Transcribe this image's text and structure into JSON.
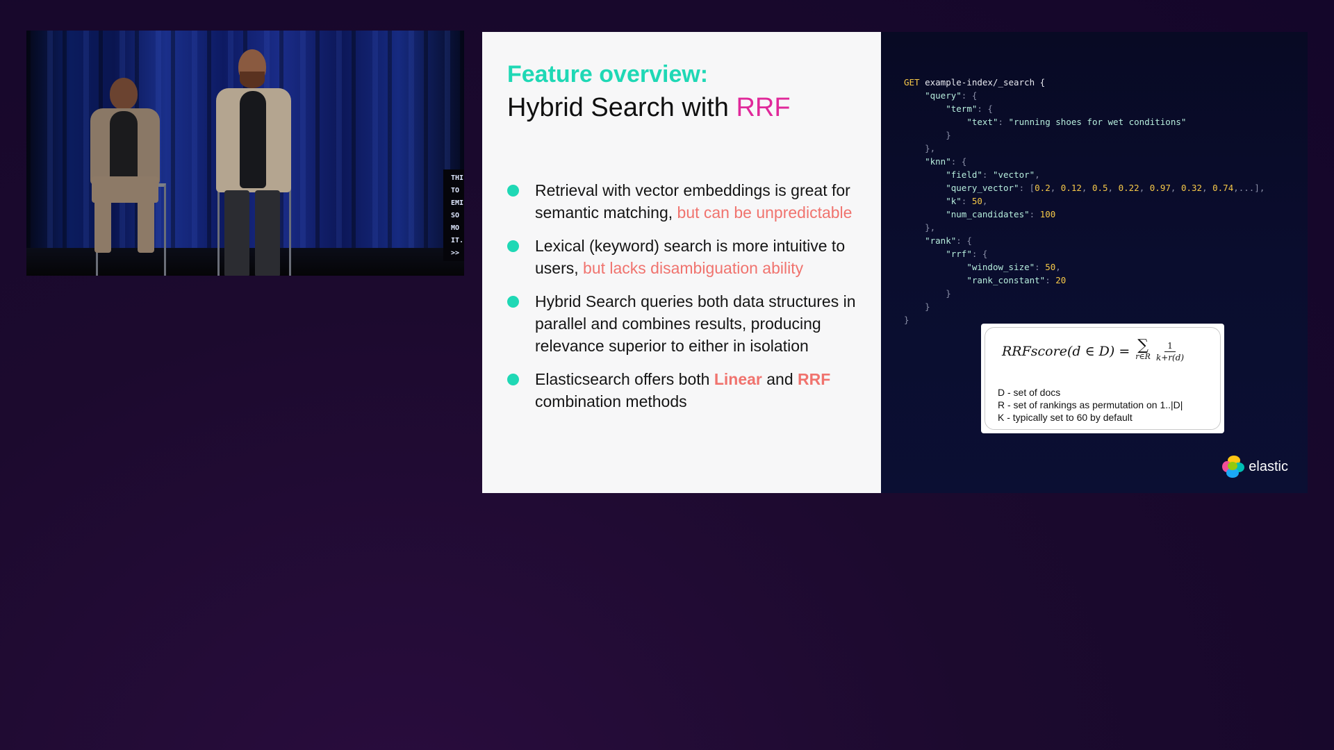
{
  "video": {
    "caption_lines": [
      "THI",
      "TO",
      "EMI",
      "SO",
      "MO",
      "IT.",
      ">>"
    ]
  },
  "slide": {
    "title_line1": "Feature overview:",
    "title_line2_prefix": "Hybrid Search with ",
    "title_line2_accent": "RRF",
    "bullets": [
      {
        "text": "Retrieval with vector embeddings is great for semantic matching, ",
        "highlight": "but can be unpredictable"
      },
      {
        "text": "Lexical (keyword) search is more intuitive to users, ",
        "highlight": "but lacks disambiguation ability"
      },
      {
        "text": "Hybrid Search queries both data structures in parallel and combines results, producing relevance superior to either in isolation"
      },
      {
        "pre": "Elasticsearch offers both ",
        "b1": "Linear",
        "mid": " and ",
        "b2": "RRF",
        "post": " combination methods"
      }
    ],
    "code_lines": [
      [
        "GET",
        " example-index/_search {"
      ],
      [
        "    \"query\": {"
      ],
      [
        "        \"term\": {"
      ],
      [
        "            \"text\": \"running shoes for wet conditions\""
      ],
      [
        "        }"
      ],
      [
        "    },"
      ],
      [
        "    \"knn\": {"
      ],
      [
        "        \"field\": \"vector\","
      ],
      [
        "        \"query_vector\": [0.2, 0.12, 0.5, 0.22, 0.97, 0.32, 0.74,...],"
      ],
      [
        "        \"k\": 50,"
      ],
      [
        "        \"num_candidates\": 100"
      ],
      [
        "    },"
      ],
      [
        "    \"rank\": {"
      ],
      [
        "        \"rrf\": {"
      ],
      [
        "            \"window_size\": 50,"
      ],
      [
        "            \"rank_constant\": 20"
      ],
      [
        "        }"
      ],
      [
        "    }"
      ],
      [
        "}"
      ]
    ],
    "formula": {
      "lhs": "RRFscore(d ∈ D) =",
      "sigma": "∑",
      "sigma_sub": "r∈R",
      "numerator": "1",
      "denominator": "k+r(d)"
    },
    "definitions": [
      "D - set of docs",
      "R - set of rankings as permutation on 1..|D|",
      "K - typically set to 60 by default"
    ],
    "logo_text": "elastic"
  },
  "colors": {
    "background": "#1c0a2e",
    "teal": "#1fd8b5",
    "magenta": "#e0299a",
    "coral": "#f0736e",
    "code_key": "#b7eedd",
    "code_number": "#f7c948"
  }
}
